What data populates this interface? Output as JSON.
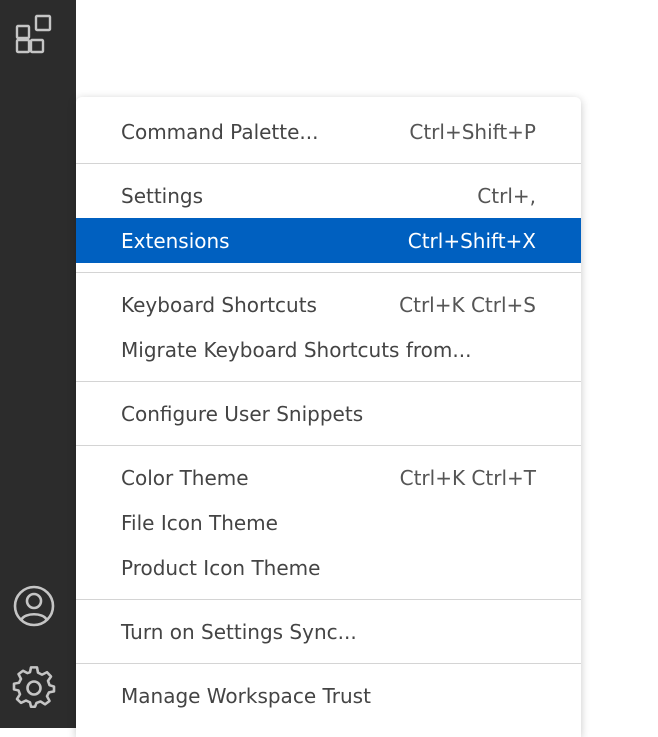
{
  "activity_bar": {
    "icons": [
      "extensions-icon",
      "account-icon",
      "gear-icon"
    ],
    "background": "#2c2c2c",
    "icon_color": "#c5c5c5"
  },
  "menu": {
    "selected_color": "#0060c0",
    "groups": [
      {
        "items": [
          {
            "label": "Command Palette...",
            "keybinding": "Ctrl+Shift+P"
          }
        ]
      },
      {
        "items": [
          {
            "label": "Settings",
            "keybinding": "Ctrl+,"
          },
          {
            "label": "Extensions",
            "keybinding": "Ctrl+Shift+X",
            "selected": true
          }
        ]
      },
      {
        "items": [
          {
            "label": "Keyboard Shortcuts",
            "keybinding": "Ctrl+K Ctrl+S"
          },
          {
            "label": "Migrate Keyboard Shortcuts from...",
            "keybinding": ""
          }
        ]
      },
      {
        "items": [
          {
            "label": "Configure User Snippets",
            "keybinding": ""
          }
        ]
      },
      {
        "items": [
          {
            "label": "Color Theme",
            "keybinding": "Ctrl+K Ctrl+T"
          },
          {
            "label": "File Icon Theme",
            "keybinding": ""
          },
          {
            "label": "Product Icon Theme",
            "keybinding": ""
          }
        ]
      },
      {
        "items": [
          {
            "label": "Turn on Settings Sync...",
            "keybinding": ""
          }
        ]
      },
      {
        "items": [
          {
            "label": "Manage Workspace Trust",
            "keybinding": ""
          }
        ]
      }
    ]
  }
}
